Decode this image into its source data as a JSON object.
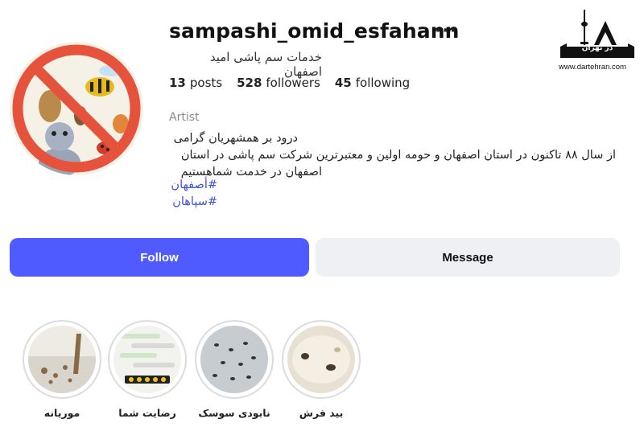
{
  "profile": {
    "username": "sampashi_omid_esfahann",
    "more_label": "···",
    "full_name": "خدمات سم پاشی امید اصفهان",
    "category": "Artist"
  },
  "stats": {
    "posts_count": "13",
    "posts_label": "posts",
    "followers_count": "528",
    "followers_label": "followers",
    "following_count": "45",
    "following_label": "following"
  },
  "bio": {
    "line1": "درود بر همشهریان گرامی",
    "line2": "از سال ۸۸ تاکنون در استان اصفهان و حومه اولین و معتبرترین شرکت سم پاشی در استان",
    "line3": "اصفهان در خدمت شماهستیم",
    "hashtags": [
      "#أصفهان",
      "#سپاهان"
    ]
  },
  "actions": {
    "follow_label": "Follow",
    "message_label": "Message"
  },
  "highlights": [
    {
      "label": "موریانه"
    },
    {
      "label": "رضایت شما"
    },
    {
      "label": "نابودی سوسک"
    },
    {
      "label": "بید فرش"
    }
  ],
  "watermark": {
    "logo_text": "در تهران",
    "url": "www.dartehran.com"
  },
  "colors": {
    "accent": "#4f5bff",
    "link": "#3d53d6",
    "secondary_button": "#eff0f3",
    "avatar_ring": "#e5533d"
  }
}
